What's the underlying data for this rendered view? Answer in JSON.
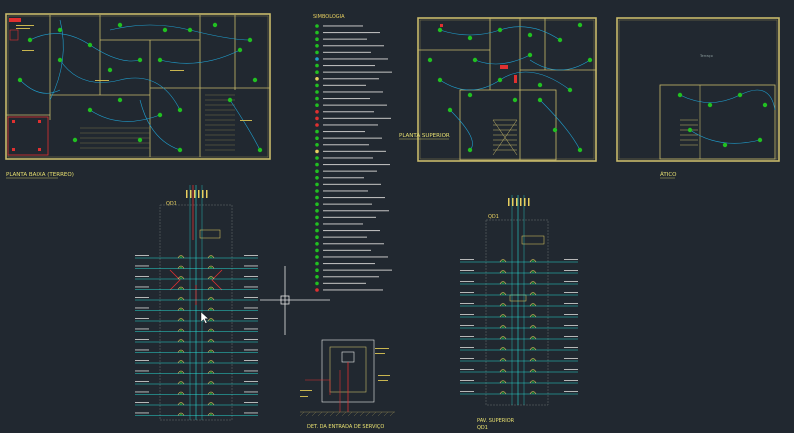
{
  "drawing": {
    "colors": {
      "background": "#212830",
      "walls": "#c7b96a",
      "walls_dark": "#8a8050",
      "wiring": "#1fa0d0",
      "fixtures": "#21c021",
      "conduit": "#e03030",
      "busbar": "#28d8d0",
      "crosshair": "#e6e6e6",
      "text": "#e8d060"
    },
    "labels": {
      "planta_baixa": "PLANTA BAIXA (TERREO)",
      "planta_superior": "PLANTA SUPERIOR",
      "atico": "ÁTICO",
      "simbologia": "SIMBOLOGIA",
      "qd1": "QD1",
      "qd1_b": "QD1",
      "det_entrada": "DET. DA ENTRADA DE SERVIÇO",
      "pav_superior": "PAV. SUPERIOR",
      "pav_superior_qd": "QD1",
      "terraco": "Terraço"
    }
  }
}
